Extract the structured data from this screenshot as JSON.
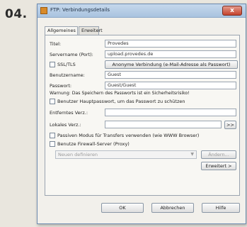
{
  "step": "04.",
  "window": {
    "title": "FTP: Verbindungsdetails",
    "close": "x"
  },
  "tabs": [
    {
      "label": "Allgemeines"
    },
    {
      "label": "Erweitert"
    }
  ],
  "form": {
    "name_label": "Titel:",
    "name_value": "Provedes",
    "server_label": "Servername (Port):",
    "server_value": "upload.provedes.de",
    "ssl_label": "SSL/TLS",
    "anon_button": "Anonyme Verbindung (e-Mail-Adresse als Passwort)",
    "user_label": "Benutzername:",
    "user_value": "Guest",
    "pass_label": "Passwort:",
    "pass_value": "Guest/Guest",
    "warning": "Warnung: Das Speichern des Passworts ist ein Sicherheitsrisiko!",
    "master_pw_label": "Benutzer Hauptpasswort, um das Passwort zu schützen",
    "remote_dir_label": "Entferntes Verz.:",
    "remote_dir_value": "",
    "local_dir_label": "Lokales Verz.:",
    "local_dir_value": "",
    "browse_button": ">>",
    "passive_label": "Passiven Modus für Transfers verwenden (wie WWW Browser)",
    "firewall_label": "Benutze Firewall-Server (Proxy)",
    "proxy_select": "Neuen definieren",
    "proxy_define_button": "Ändern...",
    "extended_button": "Erweitert >"
  },
  "footer": {
    "ok": "OK",
    "cancel": "Abbrechen",
    "help": "Hilfe"
  }
}
